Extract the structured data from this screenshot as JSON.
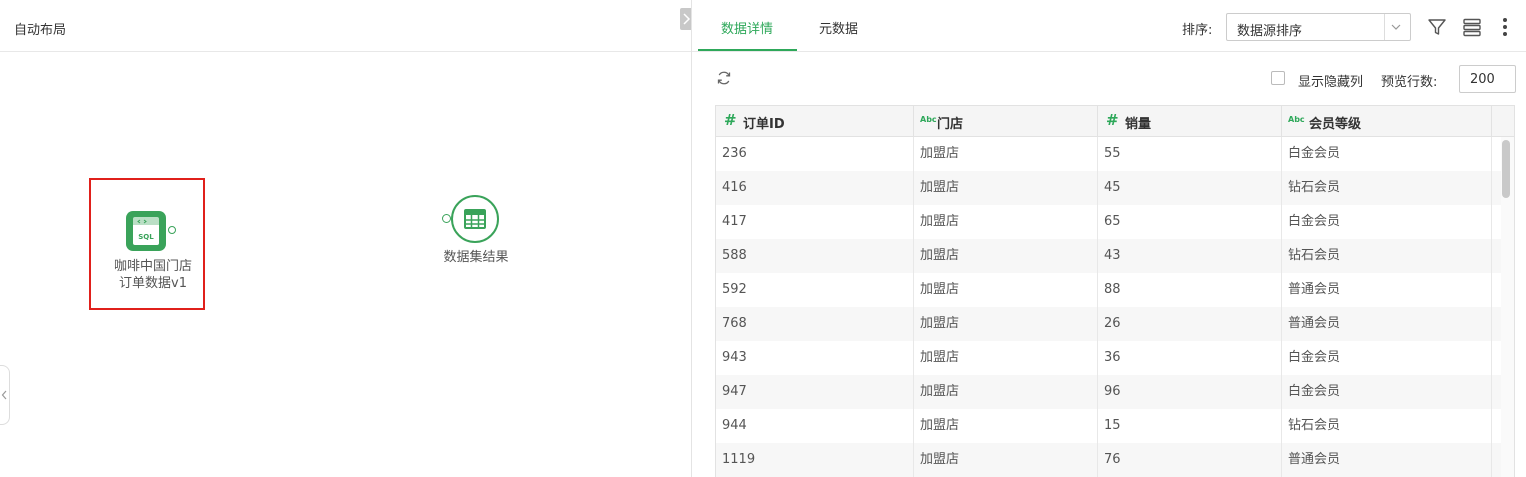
{
  "left": {
    "title": "自动布局",
    "nodes": [
      {
        "label_line1": "咖啡中国门店",
        "label_line2": "订单数据v1",
        "icon": "sql-file-icon",
        "icon_text": "SQL"
      },
      {
        "label": "数据集结果",
        "icon": "table-grid-icon"
      }
    ]
  },
  "right": {
    "tabs": [
      {
        "label": "数据详情",
        "active": true
      },
      {
        "label": "元数据",
        "active": false
      }
    ],
    "sort": {
      "label": "排序:",
      "value": "数据源排序"
    },
    "toolbar": {
      "show_hidden_label": "显示隐藏列",
      "show_hidden_checked": false,
      "preview_rows_label": "预览行数:",
      "preview_rows_value": "200"
    },
    "table": {
      "columns": [
        {
          "type": "#",
          "name": "订单ID"
        },
        {
          "type": "Abc",
          "name": "门店"
        },
        {
          "type": "#",
          "name": "销量"
        },
        {
          "type": "Abc",
          "name": "会员等级"
        }
      ],
      "rows": [
        [
          "236",
          "加盟店",
          "55",
          "白金会员"
        ],
        [
          "416",
          "加盟店",
          "45",
          "钻石会员"
        ],
        [
          "417",
          "加盟店",
          "65",
          "白金会员"
        ],
        [
          "588",
          "加盟店",
          "43",
          "钻石会员"
        ],
        [
          "592",
          "加盟店",
          "88",
          "普通会员"
        ],
        [
          "768",
          "加盟店",
          "26",
          "普通会员"
        ],
        [
          "943",
          "加盟店",
          "36",
          "白金会员"
        ],
        [
          "947",
          "加盟店",
          "96",
          "白金会员"
        ],
        [
          "944",
          "加盟店",
          "15",
          "钻石会员"
        ],
        [
          "1119",
          "加盟店",
          "76",
          "普通会员"
        ]
      ]
    }
  },
  "colors": {
    "accent": "#2ea85a",
    "selection": "#e0201b"
  }
}
